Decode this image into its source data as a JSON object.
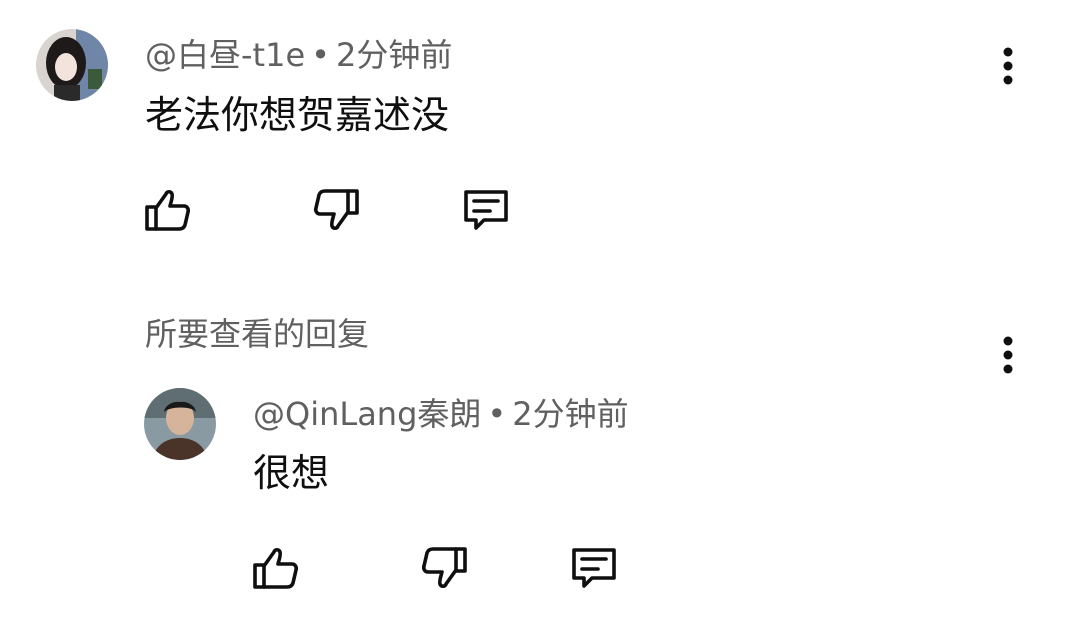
{
  "comments": [
    {
      "author": "@白昼-t1e",
      "separator": "•",
      "time": "2分钟前",
      "text": "老法你想贺嘉述没",
      "avatar_icon": "avatar-photo-girl"
    },
    {
      "author": "@QinLang秦朗",
      "separator": "•",
      "time": "2分钟前",
      "text": "很想",
      "avatar_icon": "avatar-photo-man"
    }
  ],
  "replies_header": "所要查看的回复",
  "icons": {
    "like": "thumbs-up-icon",
    "dislike": "thumbs-down-icon",
    "reply": "comment-bubble-icon",
    "more": "more-vertical-icon"
  },
  "colors": {
    "text_primary": "#0f0f0f",
    "text_secondary": "#606060",
    "background": "#ffffff"
  }
}
